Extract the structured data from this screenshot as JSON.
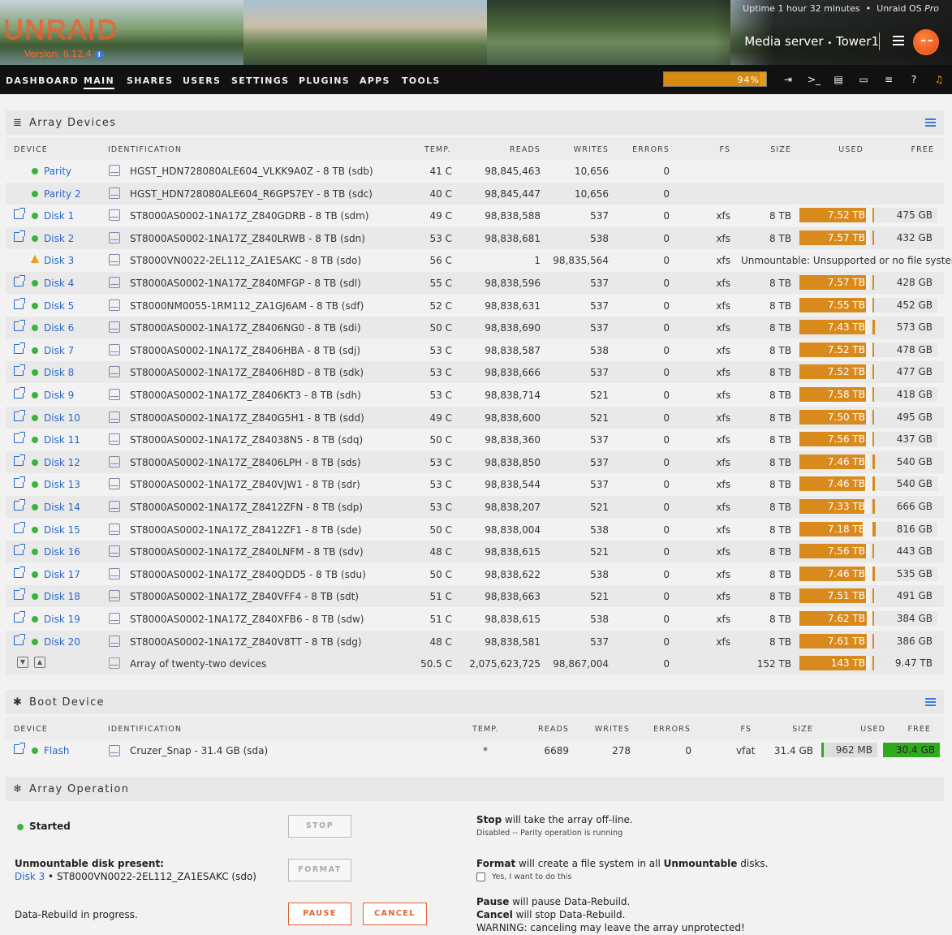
{
  "header": {
    "logo": "UNRAID",
    "version": "Version: 6.12.4",
    "uptime": "Uptime 1 hour 32 minutes",
    "os": "Unraid OS",
    "os_edition": "Pro",
    "server_description": "Media server",
    "server_name": "Tower1",
    "separator": "•"
  },
  "nav": {
    "items": [
      "DASHBOARD",
      "MAIN",
      "SHARES",
      "USERS",
      "SETTINGS",
      "PLUGINS",
      "APPS",
      "TOOLS"
    ],
    "active": "MAIN",
    "progress_label": "94%",
    "progress_value": 0.94,
    "icons": [
      "logout-icon",
      "terminal-icon",
      "feedback-icon",
      "monitor-icon",
      "log-icon",
      "help-icon",
      "bell-icon"
    ]
  },
  "array": {
    "title": "Array Devices",
    "columns": [
      "DEVICE",
      "IDENTIFICATION",
      "TEMP.",
      "READS",
      "WRITES",
      "ERRORS",
      "FS",
      "SIZE",
      "USED",
      "FREE"
    ],
    "rows": [
      {
        "device": "Parity",
        "id": "HGST_HDN728080ALE604_VLKK9A0Z - 8 TB (sdb)",
        "temp": "41 C",
        "reads": "98,845,463",
        "writes": "10,656",
        "errors": "0",
        "fs": "",
        "size": "",
        "used": "",
        "free": "",
        "status": "ok",
        "ext": false
      },
      {
        "device": "Parity 2",
        "id": "HGST_HDN728080ALE604_R6GPS7EY - 8 TB (sdc)",
        "temp": "40 C",
        "reads": "98,845,447",
        "writes": "10,656",
        "errors": "0",
        "fs": "",
        "size": "",
        "used": "",
        "free": "",
        "status": "ok",
        "ext": false
      },
      {
        "device": "Disk 1",
        "id": "ST8000AS0002-1NA17Z_Z840GDRB - 8 TB (sdm)",
        "temp": "49 C",
        "reads": "98,838,588",
        "writes": "537",
        "errors": "0",
        "fs": "xfs",
        "size": "8 TB",
        "used": "7.52 TB",
        "free": "475 GB",
        "used_frac": 0.94,
        "status": "ok",
        "ext": true
      },
      {
        "device": "Disk 2",
        "id": "ST8000AS0002-1NA17Z_Z840LRWB - 8 TB (sdn)",
        "temp": "53 C",
        "reads": "98,838,681",
        "writes": "538",
        "errors": "0",
        "fs": "xfs",
        "size": "8 TB",
        "used": "7.57 TB",
        "free": "432 GB",
        "used_frac": 0.946,
        "status": "ok",
        "ext": true
      },
      {
        "device": "Disk 3",
        "id": "ST8000VN0022-2EL112_ZA1ESAKC - 8 TB (sdo)",
        "temp": "56 C",
        "reads": "1",
        "writes": "98,835,564",
        "errors": "0",
        "fs": "xfs",
        "size": "Unmountable: Unsupported or no file system",
        "used": "",
        "free": "",
        "status": "warn",
        "ext": false
      },
      {
        "device": "Disk 4",
        "id": "ST8000AS0002-1NA17Z_Z840MFGP - 8 TB (sdl)",
        "temp": "55 C",
        "reads": "98,838,596",
        "writes": "537",
        "errors": "0",
        "fs": "xfs",
        "size": "8 TB",
        "used": "7.57 TB",
        "free": "428 GB",
        "used_frac": 0.946,
        "status": "ok",
        "ext": true
      },
      {
        "device": "Disk 5",
        "id": "ST8000NM0055-1RM112_ZA1GJ6AM - 8 TB (sdf)",
        "temp": "52 C",
        "reads": "98,838,631",
        "writes": "537",
        "errors": "0",
        "fs": "xfs",
        "size": "8 TB",
        "used": "7.55 TB",
        "free": "452 GB",
        "used_frac": 0.944,
        "status": "ok",
        "ext": true
      },
      {
        "device": "Disk 6",
        "id": "ST8000AS0002-1NA17Z_Z8406NG0 - 8 TB (sdi)",
        "temp": "50 C",
        "reads": "98,838,690",
        "writes": "537",
        "errors": "0",
        "fs": "xfs",
        "size": "8 TB",
        "used": "7.43 TB",
        "free": "573 GB",
        "used_frac": 0.929,
        "status": "ok",
        "ext": true
      },
      {
        "device": "Disk 7",
        "id": "ST8000AS0002-1NA17Z_Z8406HBA - 8 TB (sdj)",
        "temp": "53 C",
        "reads": "98,838,587",
        "writes": "538",
        "errors": "0",
        "fs": "xfs",
        "size": "8 TB",
        "used": "7.52 TB",
        "free": "478 GB",
        "used_frac": 0.94,
        "status": "ok",
        "ext": true
      },
      {
        "device": "Disk 8",
        "id": "ST8000AS0002-1NA17Z_Z8406H8D - 8 TB (sdk)",
        "temp": "53 C",
        "reads": "98,838,666",
        "writes": "537",
        "errors": "0",
        "fs": "xfs",
        "size": "8 TB",
        "used": "7.52 TB",
        "free": "477 GB",
        "used_frac": 0.94,
        "status": "ok",
        "ext": true
      },
      {
        "device": "Disk 9",
        "id": "ST8000AS0002-1NA17Z_Z8406KT3 - 8 TB (sdh)",
        "temp": "53 C",
        "reads": "98,838,714",
        "writes": "521",
        "errors": "0",
        "fs": "xfs",
        "size": "8 TB",
        "used": "7.58 TB",
        "free": "418 GB",
        "used_frac": 0.948,
        "status": "ok",
        "ext": true
      },
      {
        "device": "Disk 10",
        "id": "ST8000AS0002-1NA17Z_Z840G5H1 - 8 TB (sdd)",
        "temp": "49 C",
        "reads": "98,838,600",
        "writes": "521",
        "errors": "0",
        "fs": "xfs",
        "size": "8 TB",
        "used": "7.50 TB",
        "free": "495 GB",
        "used_frac": 0.938,
        "status": "ok",
        "ext": true
      },
      {
        "device": "Disk 11",
        "id": "ST8000AS0002-1NA17Z_Z84038N5 - 8 TB (sdq)",
        "temp": "50 C",
        "reads": "98,838,360",
        "writes": "537",
        "errors": "0",
        "fs": "xfs",
        "size": "8 TB",
        "used": "7.56 TB",
        "free": "437 GB",
        "used_frac": 0.945,
        "status": "ok",
        "ext": true
      },
      {
        "device": "Disk 12",
        "id": "ST8000AS0002-1NA17Z_Z8406LPH - 8 TB (sds)",
        "temp": "53 C",
        "reads": "98,838,850",
        "writes": "537",
        "errors": "0",
        "fs": "xfs",
        "size": "8 TB",
        "used": "7.46 TB",
        "free": "540 GB",
        "used_frac": 0.933,
        "status": "ok",
        "ext": true
      },
      {
        "device": "Disk 13",
        "id": "ST8000AS0002-1NA17Z_Z840VJW1 - 8 TB (sdr)",
        "temp": "53 C",
        "reads": "98,838,544",
        "writes": "537",
        "errors": "0",
        "fs": "xfs",
        "size": "8 TB",
        "used": "7.46 TB",
        "free": "540 GB",
        "used_frac": 0.933,
        "status": "ok",
        "ext": true
      },
      {
        "device": "Disk 14",
        "id": "ST8000AS0002-1NA17Z_Z8412ZFN - 8 TB (sdp)",
        "temp": "53 C",
        "reads": "98,838,207",
        "writes": "521",
        "errors": "0",
        "fs": "xfs",
        "size": "8 TB",
        "used": "7.33 TB",
        "free": "666 GB",
        "used_frac": 0.916,
        "status": "ok",
        "ext": true
      },
      {
        "device": "Disk 15",
        "id": "ST8000AS0002-1NA17Z_Z8412ZF1 - 8 TB (sde)",
        "temp": "50 C",
        "reads": "98,838,004",
        "writes": "538",
        "errors": "0",
        "fs": "xfs",
        "size": "8 TB",
        "used": "7.18 TB",
        "free": "816 GB",
        "used_frac": 0.898,
        "status": "ok",
        "ext": true
      },
      {
        "device": "Disk 16",
        "id": "ST8000AS0002-1NA17Z_Z840LNFM - 8 TB (sdv)",
        "temp": "48 C",
        "reads": "98,838,615",
        "writes": "521",
        "errors": "0",
        "fs": "xfs",
        "size": "8 TB",
        "used": "7.56 TB",
        "free": "443 GB",
        "used_frac": 0.945,
        "status": "ok",
        "ext": true
      },
      {
        "device": "Disk 17",
        "id": "ST8000AS0002-1NA17Z_Z840QDD5 - 8 TB (sdu)",
        "temp": "50 C",
        "reads": "98,838,622",
        "writes": "538",
        "errors": "0",
        "fs": "xfs",
        "size": "8 TB",
        "used": "7.46 TB",
        "free": "535 GB",
        "used_frac": 0.933,
        "status": "ok",
        "ext": true
      },
      {
        "device": "Disk 18",
        "id": "ST8000AS0002-1NA17Z_Z840VFF4 - 8 TB (sdt)",
        "temp": "51 C",
        "reads": "98,838,663",
        "writes": "521",
        "errors": "0",
        "fs": "xfs",
        "size": "8 TB",
        "used": "7.51 TB",
        "free": "491 GB",
        "used_frac": 0.939,
        "status": "ok",
        "ext": true
      },
      {
        "device": "Disk 19",
        "id": "ST8000AS0002-1NA17Z_Z840XFB6 - 8 TB (sdw)",
        "temp": "51 C",
        "reads": "98,838,615",
        "writes": "538",
        "errors": "0",
        "fs": "xfs",
        "size": "8 TB",
        "used": "7.62 TB",
        "free": "384 GB",
        "used_frac": 0.952,
        "status": "ok",
        "ext": true
      },
      {
        "device": "Disk 20",
        "id": "ST8000AS0002-1NA17Z_Z840V8TT - 8 TB (sdg)",
        "temp": "48 C",
        "reads": "98,838,581",
        "writes": "537",
        "errors": "0",
        "fs": "xfs",
        "size": "8 TB",
        "used": "7.61 TB",
        "free": "386 GB",
        "used_frac": 0.951,
        "status": "ok",
        "ext": true
      }
    ],
    "summary": {
      "id": "Array of twenty-two devices",
      "temp": "50.5 C",
      "reads": "2,075,623,725",
      "writes": "98,867,004",
      "errors": "0",
      "size": "152 TB",
      "used": "143 TB",
      "free": "9.47 TB",
      "used_frac": 0.94
    }
  },
  "boot": {
    "title": "Boot Device",
    "columns": [
      "DEVICE",
      "IDENTIFICATION",
      "TEMP.",
      "READS",
      "WRITES",
      "ERRORS",
      "FS",
      "SIZE",
      "USED",
      "FREE"
    ],
    "row": {
      "device": "Flash",
      "id": "Cruzer_Snap - 31.4 GB (sda)",
      "temp": "*",
      "reads": "6689",
      "writes": "278",
      "errors": "0",
      "fs": "vfat",
      "size": "31.4 GB",
      "used": "962 MB",
      "free": "30.4 GB",
      "used_frac": 0.03
    }
  },
  "operation": {
    "title": "Array Operation",
    "status": "Started",
    "stop_label": "STOP",
    "stop_desc_bold": "Stop",
    "stop_desc": " will take the array off-line.",
    "stop_note": "Disabled -- Parity operation is running",
    "unmountable_title": "Unmountable disk present:",
    "unmountable_disk": "Disk 3",
    "unmountable_id": " • ST8000VN0022-2EL112_ZA1ESAKC (sdo)",
    "format_label": "FORMAT",
    "format_desc_bold": "Format",
    "format_desc_mid": " will create a file system in all ",
    "format_desc_bold2": "Unmountable",
    "format_desc_end": " disks.",
    "format_check": "Yes, I want to do this",
    "rebuild_text": "Data-Rebuild in progress.",
    "pause_label": "PAUSE",
    "cancel_label": "CANCEL",
    "pause_desc_bold": "Pause",
    "pause_desc": " will pause Data-Rebuild.",
    "cancel_desc_bold": "Cancel",
    "cancel_desc": " will stop Data-Rebuild.",
    "warning": "WARNING: canceling may leave the array unprotected!"
  },
  "colors": {
    "accent": "#e06232",
    "bar": "#d98a1d",
    "ok": "#3cb33c",
    "link": "#2a68c8",
    "free_green": "#2faa1f"
  }
}
